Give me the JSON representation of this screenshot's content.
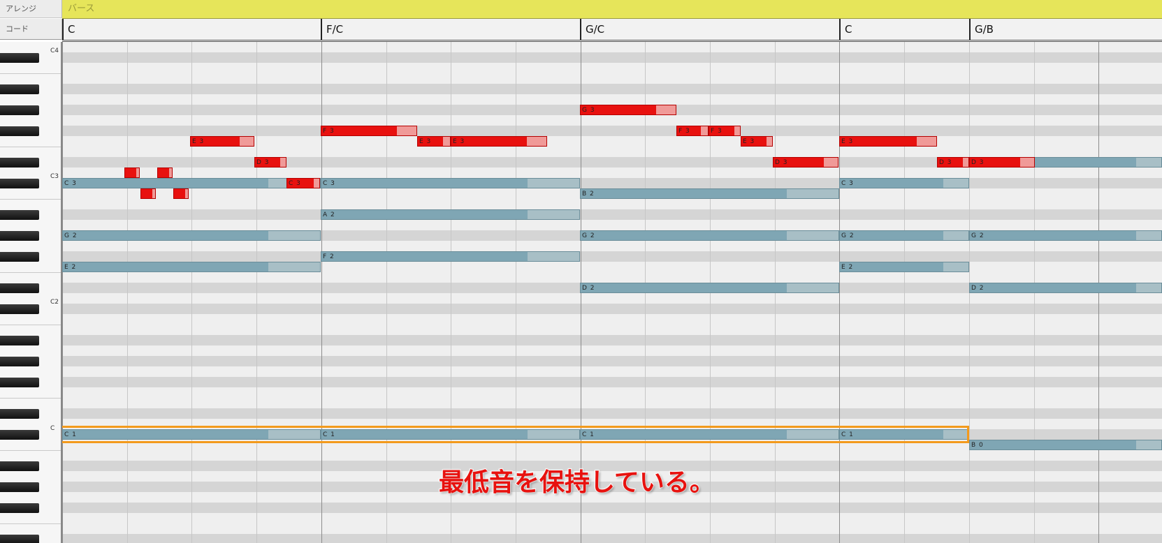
{
  "header": {
    "arrange_label": "アレンジ",
    "chord_label": "コード",
    "section_name": "バース"
  },
  "chords": [
    "C",
    "F/C",
    "G/C",
    "C",
    "G/B"
  ],
  "keyboard": {
    "octave_labels": [
      "C4",
      "C3",
      "C2",
      "C"
    ]
  },
  "notes": {
    "melody": [
      {
        "label": ""
      },
      {
        "label": ""
      },
      {
        "label": ""
      },
      {
        "label": ""
      },
      {
        "label": "E3"
      },
      {
        "label": "D3"
      },
      {
        "label": "C3"
      },
      {
        "label": "F3"
      },
      {
        "label": "E3"
      },
      {
        "label": "E3"
      },
      {
        "label": "G3"
      },
      {
        "label": "F3"
      },
      {
        "label": "F3"
      },
      {
        "label": "E3"
      },
      {
        "label": "D3"
      },
      {
        "label": "E3"
      },
      {
        "label": "D3"
      },
      {
        "label": "D3"
      }
    ],
    "chord_tones": [
      {
        "label": "C3"
      },
      {
        "label": "G2"
      },
      {
        "label": "E2"
      },
      {
        "label": "C1"
      },
      {
        "label": "C3"
      },
      {
        "label": "A2"
      },
      {
        "label": "F2"
      },
      {
        "label": "C1"
      },
      {
        "label": "B2"
      },
      {
        "label": "G2"
      },
      {
        "label": "D2"
      },
      {
        "label": "C1"
      },
      {
        "label": "C3"
      },
      {
        "label": "G2"
      },
      {
        "label": "E2"
      },
      {
        "label": "C1"
      },
      {
        "label": ""
      },
      {
        "label": "G2"
      },
      {
        "label": "D2"
      },
      {
        "label": "B0"
      }
    ]
  },
  "annotation": {
    "caption": "最低音を保持している。",
    "highlight_color": "#f39a1c"
  },
  "colors": {
    "arrange_strip": "#e6e55a",
    "melody_note": "#e8110f",
    "chord_note": "#7fa6b4"
  }
}
